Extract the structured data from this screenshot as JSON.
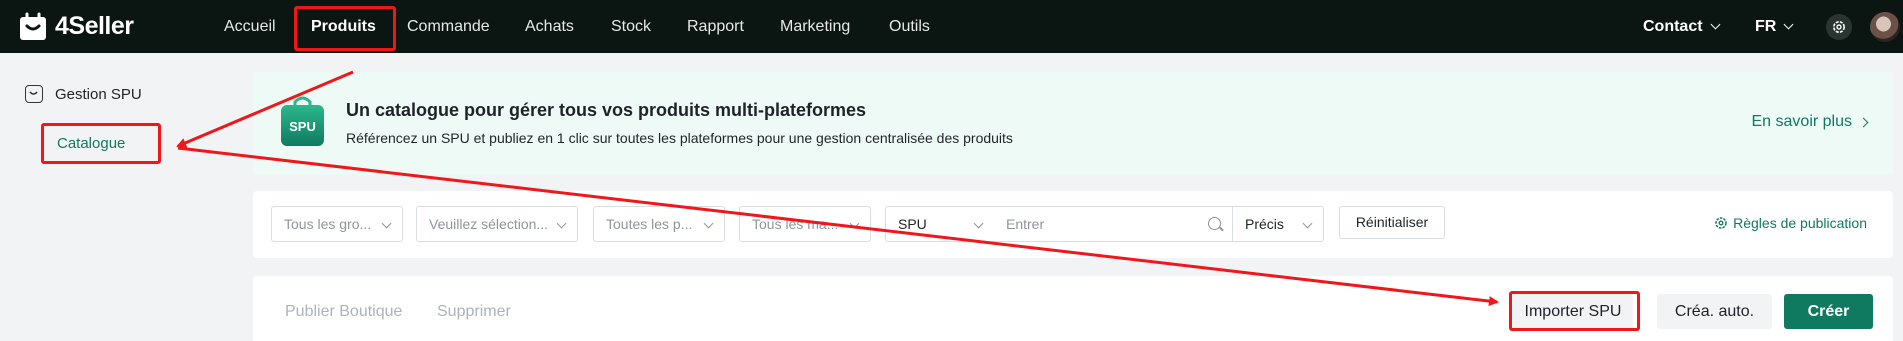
{
  "brand": {
    "name": "4Seller"
  },
  "nav": {
    "items": [
      {
        "label": "Accueil"
      },
      {
        "label": "Produits"
      },
      {
        "label": "Commande"
      },
      {
        "label": "Achats"
      },
      {
        "label": "Stock"
      },
      {
        "label": "Rapport"
      },
      {
        "label": "Marketing"
      },
      {
        "label": "Outils"
      }
    ],
    "contact": "Contact",
    "language": "FR"
  },
  "sidebar": {
    "group": "Gestion SPU",
    "item": "Catalogue"
  },
  "banner": {
    "icon_text": "SPU",
    "title": "Un catalogue pour gérer tous vos produits multi-plateformes",
    "subtitle": "Référencez un SPU et publiez en 1 clic sur toutes les plateformes pour une gestion centralisée des produits",
    "learn_more": "En savoir plus"
  },
  "filters": {
    "group_select": "Tous les gro...",
    "select2": "Veuillez sélection...",
    "select3": "Toutes les p...",
    "select4": "Tous les ma...",
    "field_select": "SPU",
    "search_placeholder": "Entrer",
    "match_select": "Précis",
    "reset": "Réinitialiser",
    "rules": "Règles de publication"
  },
  "actions": {
    "publish_shop": "Publier Boutique",
    "delete": "Supprimer",
    "import_spu": "Importer SPU",
    "auto_create": "Créa. auto.",
    "create": "Créer"
  },
  "colors": {
    "accent": "#0f7a5f",
    "topbar": "#0b1512",
    "annotation": "#f0161a"
  }
}
